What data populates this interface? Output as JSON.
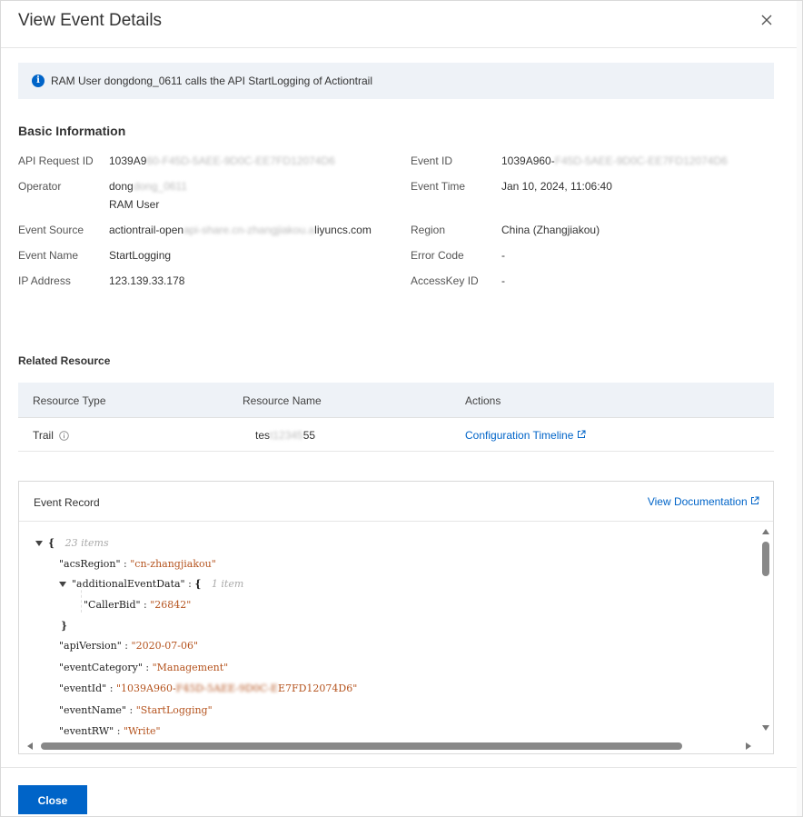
{
  "dialog": {
    "title": "View Event Details",
    "close_icon": "close-icon"
  },
  "notice": {
    "text": "RAM User dongdong_0611 calls the API StartLogging of Actiontrail",
    "icon": "info-icon"
  },
  "basic": {
    "title": "Basic Information",
    "api_request_id": {
      "label": "API Request ID",
      "value_a": "1039A9",
      "value_b": "60-F45D-5AEE-9D0C-EE7FD12074D6"
    },
    "operator": {
      "label": "Operator",
      "value_a": "dong",
      "value_b": "dong_0611",
      "type": "RAM User"
    },
    "event_source": {
      "label": "Event Source",
      "value_a": "actiontrail-open",
      "value_b": "api-share.cn-zhangjiakou.a",
      "value_c": "liyuncs.com"
    },
    "event_name": {
      "label": "Event Name",
      "value": "StartLogging"
    },
    "ip_address": {
      "label": "IP Address",
      "value": "123.139.33.178"
    },
    "event_id": {
      "label": "Event ID",
      "value_a": "1039A960-",
      "value_b": "F45D-5AEE-9D0C-EE7FD12074D6"
    },
    "event_time": {
      "label": "Event Time",
      "value": "Jan 10, 2024, 11:06:40"
    },
    "region": {
      "label": "Region",
      "value": "China (Zhangjiakou)"
    },
    "error_code": {
      "label": "Error Code",
      "value": "-"
    },
    "accesskey_id": {
      "label": "AccessKey ID",
      "value": "-"
    }
  },
  "related": {
    "title": "Related Resource",
    "columns": [
      "Resource Type",
      "Resource Name",
      "Actions"
    ],
    "row": {
      "type": "Trail",
      "name_a": "tes",
      "name_b": "t12345",
      "name_c": "55",
      "action": "Configuration Timeline"
    }
  },
  "record": {
    "title": "Event Record",
    "doc_link": "View Documentation",
    "lines": {
      "root_brace": "{",
      "root_meta": "23 items",
      "l1_key": "\"acsRegion\"",
      "l1_val": "\"cn-zhangjiakou\"",
      "l2_key": "\"additionalEventData\"",
      "l2_brace": "{",
      "l2_meta": "1 item",
      "l3_key": "\"CallerBid\"",
      "l3_val": "\"26842\"",
      "l4": "}",
      "l5_key": "\"apiVersion\"",
      "l5_val": "\"2020-07-06\"",
      "l6_key": "\"eventCategory\"",
      "l6_val": "\"Management\"",
      "l7_key": "\"eventId\"",
      "l7_val_a": "\"1039A960-",
      "l7_val_b": "F45D-5AEE-9D0C-E",
      "l7_val_c": "E7FD12074D6\"",
      "l8_key": "\"eventName\"",
      "l8_val": "\"StartLogging\"",
      "l9_key": "\"eventRW\"",
      "l9_val": "\"Write\"",
      "sep": " : "
    }
  },
  "footer": {
    "close_label": "Close"
  }
}
